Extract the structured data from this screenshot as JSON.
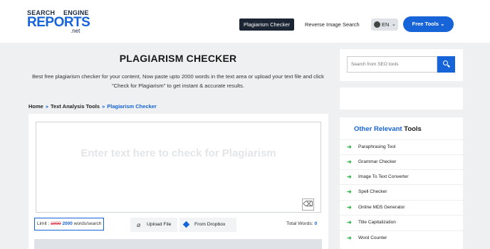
{
  "header": {
    "logo": {
      "line1a": "SEARCH",
      "line1b": "ENGINE",
      "line2": "REPORTS",
      "line3": ".net"
    },
    "nav": {
      "plagiarism": "Plagiarism Checker",
      "reverse": "Reverse Image Search"
    },
    "lang": {
      "label": "EN",
      "chevron": "⌄"
    },
    "free_tools": "Free Tools ⌄"
  },
  "main": {
    "title": "PLAGIARISM CHECKER",
    "description": "Best free plagiarism checker for your content, Now paste upto 2000 words in the text area or upload your text file and click \"Check for Plagiarism\" to get instant & accurate results.",
    "breadcrumb": [
      "Home",
      "Text Analysis Tools",
      "Plagiarism Checker"
    ],
    "breadcrumb_sep": "»",
    "editor": {
      "placeholder": "Enter text here to check for Plagiarism",
      "clear_icon": "⌫"
    },
    "limit": {
      "prefix": "Limit : ",
      "old": "1000",
      "new": "2000",
      "suffix": " words/search"
    },
    "upload_label": "Upload File",
    "upload_icon": "⌀",
    "dropbox_label": "From Dropbox",
    "total_words_label": "Total Words: ",
    "total_words_value": "0"
  },
  "sidebar": {
    "search_placeholder": "Search from SEO tools",
    "relevant_title_a": "Other Relevant",
    "relevant_title_b": " Tools",
    "tools": [
      "Paraphrasing Tool",
      "Grammar Checker",
      "Image To Text Converter",
      "Spell Checker",
      "Online MD5 Generator",
      "Title Capitalization",
      "Word Counter"
    ],
    "arrow": "➜"
  },
  "colors": {
    "accent": "#1763d8",
    "dark": "#1c2533",
    "green": "#2fb24a"
  }
}
